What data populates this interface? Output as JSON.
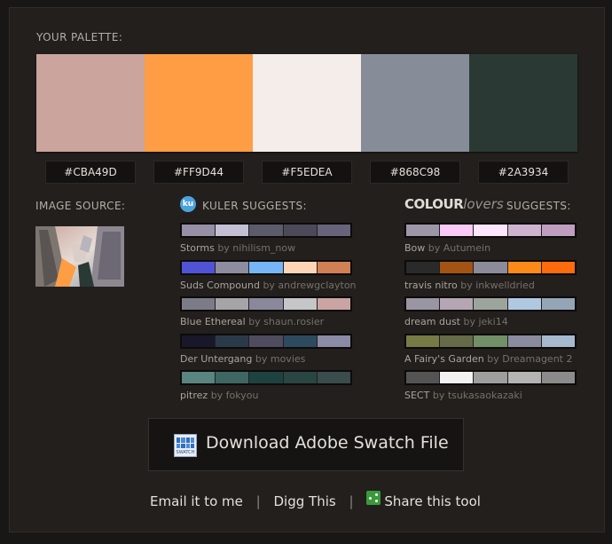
{
  "palette": {
    "title": "YOUR PALETTE:",
    "colors": [
      "#CBA49D",
      "#FF9D44",
      "#F5EDEA",
      "#868C98",
      "#2A3934"
    ]
  },
  "image_source": {
    "title": "IMAGE SOURCE:"
  },
  "kuler": {
    "title": "KULER SUGGESTS:",
    "logo_text": "ku",
    "items": [
      {
        "name": "Storms",
        "by": "by nihilism_now",
        "colors": [
          "#9590a6",
          "#c3c0d6",
          "#5c5b6a",
          "#4c4a58",
          "#66637a"
        ]
      },
      {
        "name": "Suds Compound",
        "by": "by andrewgclayton",
        "colors": [
          "#5153d6",
          "#8e8c9f",
          "#76b6f8",
          "#fdd5b6",
          "#d17f55"
        ]
      },
      {
        "name": "Blue Ethereal",
        "by": "by shaun.rosier",
        "colors": [
          "#7c7c89",
          "#a7a4a8",
          "#8a899b",
          "#c6c5c8",
          "#c9a4a3"
        ]
      },
      {
        "name": "Der Untergang",
        "by": "by movies",
        "colors": [
          "#18182a",
          "#2a3a4a",
          "#4e4c5e",
          "#2e4a5e",
          "#8b8ba6"
        ]
      },
      {
        "name": "pitrez",
        "by": "by fokyou",
        "colors": [
          "#5a8480",
          "#3e6663",
          "#1e423f",
          "#294643",
          "#3a4c4b"
        ]
      }
    ]
  },
  "colourlovers": {
    "title": "SUGGESTS:",
    "logo_bold": "COLOUR",
    "logo_light": "lovers",
    "items": [
      {
        "name": "Bow",
        "by": "by Autumein",
        "colors": [
          "#9c97a8",
          "#fbc9f5",
          "#fce6fd",
          "#ceb3cf",
          "#c09ec0"
        ]
      },
      {
        "name": "travis nitro",
        "by": "by inkwelldried",
        "colors": [
          "#2a2a2a",
          "#a35314",
          "#8b8b9a",
          "#fb8a18",
          "#ff6a0c"
        ]
      },
      {
        "name": "dream dust",
        "by": "by jeki14",
        "colors": [
          "#9995a2",
          "#b4a6b3",
          "#9ca59c",
          "#b1c8e3",
          "#94a6b6"
        ]
      },
      {
        "name": "A Fairy's Garden",
        "by": "by Dreamagent 2",
        "colors": [
          "#767b45",
          "#656a48",
          "#729067",
          "#8b8ba0",
          "#a7b9cf"
        ]
      },
      {
        "name": "SECT",
        "by": "by tsukasaokazaki",
        "colors": [
          "#545454",
          "#f2f2f2",
          "#9e9e9e",
          "#b4b4b4",
          "#8b8b8b"
        ]
      }
    ]
  },
  "download": {
    "label": "Download Adobe Swatch File",
    "icon_caption": "SWATCH"
  },
  "links": {
    "email": "Email it to me",
    "digg": "Digg This",
    "share": "Share this tool",
    "separator": "|"
  }
}
